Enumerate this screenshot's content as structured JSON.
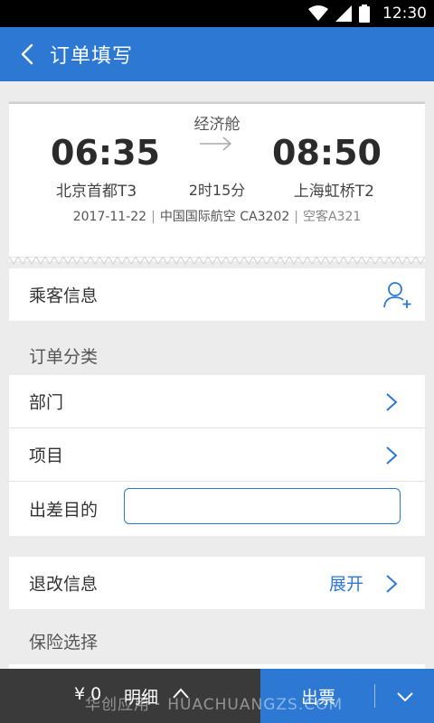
{
  "status_bar": {
    "time": "12:30"
  },
  "header": {
    "title": "订单填写"
  },
  "flight": {
    "cabin": "经济舱",
    "departure_time": "06:35",
    "arrival_time": "08:50",
    "departure_airport": "北京首都T3",
    "arrival_airport": "上海虹桥T2",
    "duration": "2时15分",
    "date": "2017-11-22",
    "airline_flight": "中国国际航空 CA3202",
    "aircraft": "空客A321"
  },
  "passenger": {
    "label": "乘客信息"
  },
  "order_category": {
    "section_label": "订单分类",
    "department_label": "部门",
    "project_label": "项目",
    "purpose_label": "出差目的",
    "purpose_value": ""
  },
  "refund_change": {
    "label": "退改信息",
    "expand_label": "展开"
  },
  "insurance": {
    "section_label": "保险选择"
  },
  "bottom": {
    "total": "¥ 0",
    "detail_label": "明细",
    "issue_label": "出票"
  },
  "watermark": "华创应用 · HUACHUANGZS.COM",
  "colors": {
    "primary": "#2d78d2",
    "bottom_bar": "#3a3a3a",
    "background": "#ececec"
  }
}
